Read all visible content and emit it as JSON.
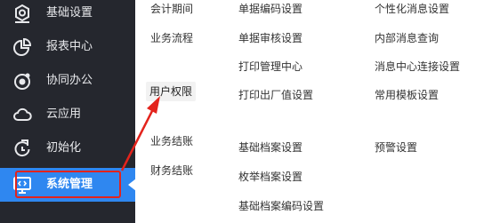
{
  "sidebar": {
    "items": [
      {
        "label": "基础设置",
        "icon": "settings-gear-icon",
        "active": false
      },
      {
        "label": "报表中心",
        "icon": "pie-chart-icon",
        "active": false
      },
      {
        "label": "协同办公",
        "icon": "target-collaboration-icon",
        "active": false
      },
      {
        "label": "云应用",
        "icon": "cloud-icon",
        "active": false
      },
      {
        "label": "初始化",
        "icon": "refresh-init-icon",
        "active": false
      },
      {
        "label": "系统管理",
        "icon": "system-monitor-icon",
        "active": true
      }
    ]
  },
  "menu": {
    "col1": [
      "会计期间",
      "业务流程",
      "用户权限",
      "业务结账",
      "财务结账"
    ],
    "col2": [
      "单据编码设置",
      "单据审核设置",
      "打印管理中心",
      "打印出厂值设置",
      "基础档案设置",
      "枚举档案设置",
      "基础档案编码设置"
    ],
    "col3": [
      "个性化消息设置",
      "内部消息查询",
      "消息中心连接设置",
      "常用模板设置",
      "预警设置"
    ]
  },
  "colors": {
    "sidebar_bg": "#25272e",
    "active_bg": "#2f87f0",
    "annotation_red": "#e3231c"
  }
}
